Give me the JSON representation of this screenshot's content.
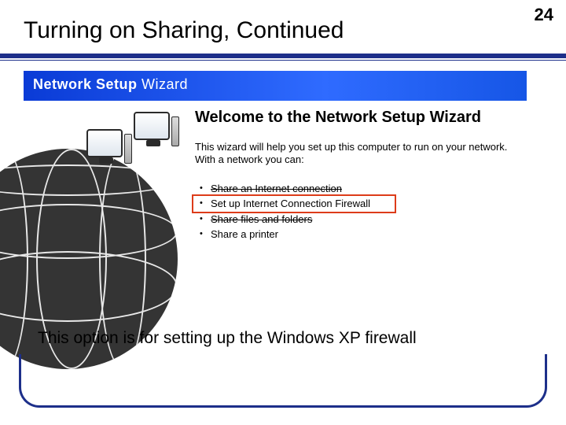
{
  "slide": {
    "number": "24",
    "title": "Turning on Sharing, Continued",
    "caption": "This option is for setting up the Windows XP firewall"
  },
  "wizard": {
    "header_bold": "Network Setup",
    "header_light": " Wizard",
    "welcome": "Welcome to the Network Setup Wizard",
    "lead": "This wizard will help you set up this computer to run on your network. With a network you can:",
    "bullets": {
      "0": "Share an Internet connection",
      "1": "Set up Internet Connection Firewall",
      "2": "Share files and folders",
      "3": "Share a printer"
    }
  }
}
